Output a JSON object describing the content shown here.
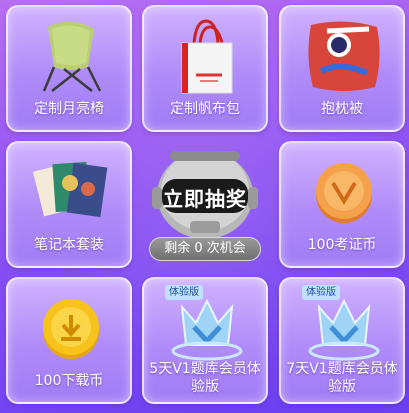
{
  "prizes": [
    {
      "label": "定制月亮椅",
      "icon": "moon-chair-icon"
    },
    {
      "label": "定制帆布包",
      "icon": "canvas-bag-icon"
    },
    {
      "label": "抱枕被",
      "icon": "pillow-icon"
    },
    {
      "label": "笔记本套装",
      "icon": "notebook-set-icon"
    },
    {
      "label": "100考证币",
      "icon": "coin-icon"
    },
    {
      "label": "100下载币",
      "icon": "download-coin-icon"
    },
    {
      "label": "5天V1题库会员体验版",
      "icon": "vip-crown-icon",
      "badge": "体验版"
    },
    {
      "label": "7天V1题库会员体验版",
      "icon": "vip-crown-icon",
      "badge": "体验版"
    }
  ],
  "lottery": {
    "button_label": "立即抽奖",
    "chances_text": "剩余 0 次机会"
  },
  "colors": {
    "tile_top": "#d0b2ff",
    "tile_bottom": "#a07cf6",
    "background": "#8a4cf0",
    "coin_orange": "#f5a04a",
    "coin_yellow": "#f7c21c",
    "badge_bg": "#bfe0ff"
  }
}
